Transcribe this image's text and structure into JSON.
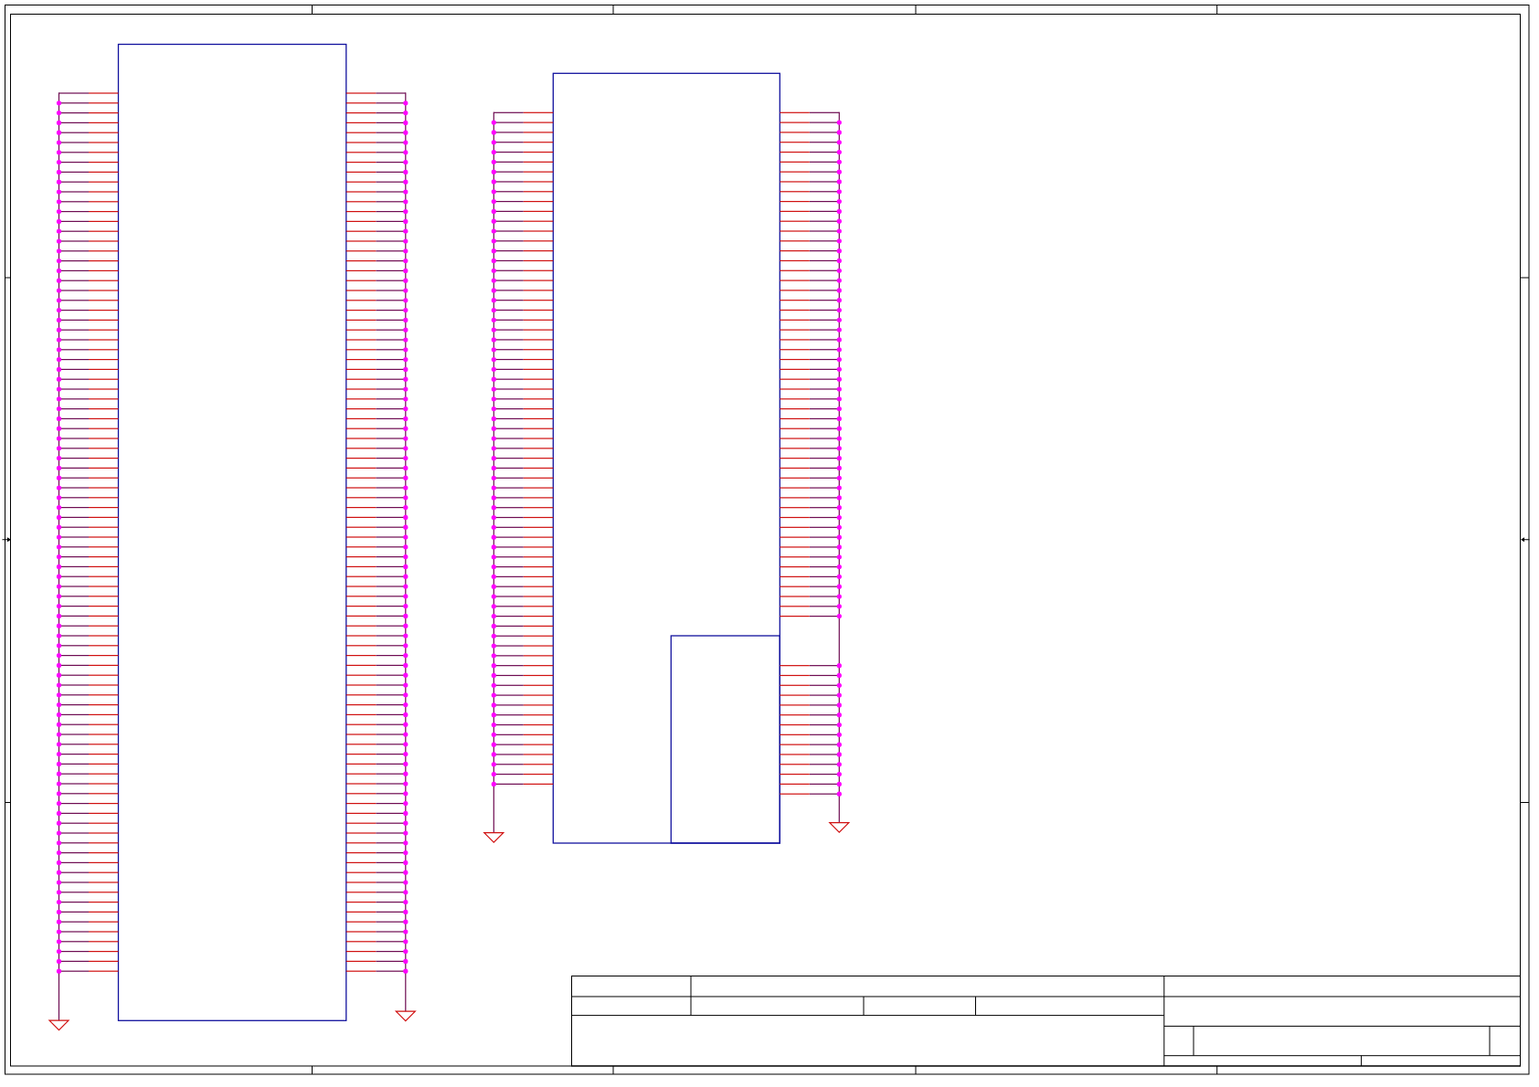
{
  "schematic": {
    "frame": true,
    "title_block": true,
    "components": [
      {
        "left_bus": {
          "ground": true,
          "pins": [
            {
              "kind": "pin"
            },
            {
              "kind": "pin"
            },
            {
              "kind": "pin"
            },
            {
              "kind": "pin"
            },
            {
              "kind": "pin"
            },
            {
              "kind": "pin"
            },
            {
              "kind": "pin"
            },
            {
              "kind": "pin"
            },
            {
              "kind": "pin"
            },
            {
              "kind": "pin"
            },
            {
              "kind": "pin"
            },
            {
              "kind": "pin"
            },
            {
              "kind": "pin"
            },
            {
              "kind": "pin"
            },
            {
              "kind": "pin"
            },
            {
              "kind": "pin"
            },
            {
              "kind": "pin"
            },
            {
              "kind": "pin"
            },
            {
              "kind": "pin"
            },
            {
              "kind": "pin"
            },
            {
              "kind": "pin"
            },
            {
              "kind": "pin"
            },
            {
              "kind": "pin"
            },
            {
              "kind": "pin"
            },
            {
              "kind": "pin"
            },
            {
              "kind": "pin"
            },
            {
              "kind": "pin"
            },
            {
              "kind": "pin"
            },
            {
              "kind": "pin"
            },
            {
              "kind": "pin"
            },
            {
              "kind": "pin"
            },
            {
              "kind": "pin"
            },
            {
              "kind": "pin"
            },
            {
              "kind": "pin"
            },
            {
              "kind": "pin"
            },
            {
              "kind": "pin"
            },
            {
              "kind": "pin"
            },
            {
              "kind": "pin"
            },
            {
              "kind": "pin"
            },
            {
              "kind": "pin"
            },
            {
              "kind": "pin"
            },
            {
              "kind": "pin"
            },
            {
              "kind": "pin"
            },
            {
              "kind": "pin"
            },
            {
              "kind": "pin"
            },
            {
              "kind": "pin"
            },
            {
              "kind": "pin"
            },
            {
              "kind": "pin"
            },
            {
              "kind": "pin"
            },
            {
              "kind": "pin"
            },
            {
              "kind": "pin"
            },
            {
              "kind": "pin"
            },
            {
              "kind": "pin"
            },
            {
              "kind": "pin"
            },
            {
              "kind": "pin"
            },
            {
              "kind": "pin"
            },
            {
              "kind": "pin"
            },
            {
              "kind": "pin"
            },
            {
              "kind": "pin"
            },
            {
              "kind": "pin"
            },
            {
              "kind": "pin"
            },
            {
              "kind": "pin"
            },
            {
              "kind": "pin"
            },
            {
              "kind": "pin"
            },
            {
              "kind": "pin"
            },
            {
              "kind": "pin"
            },
            {
              "kind": "pin"
            },
            {
              "kind": "pin"
            },
            {
              "kind": "pin"
            },
            {
              "kind": "pin"
            },
            {
              "kind": "pin"
            },
            {
              "kind": "pin"
            },
            {
              "kind": "pin"
            },
            {
              "kind": "pin"
            },
            {
              "kind": "pin"
            },
            {
              "kind": "pin"
            },
            {
              "kind": "pin"
            },
            {
              "kind": "pin"
            },
            {
              "kind": "pin"
            },
            {
              "kind": "pin"
            },
            {
              "kind": "pin"
            },
            {
              "kind": "pin"
            },
            {
              "kind": "pin"
            },
            {
              "kind": "pin"
            },
            {
              "kind": "pin"
            },
            {
              "kind": "pin"
            },
            {
              "kind": "pin"
            },
            {
              "kind": "pin"
            },
            {
              "kind": "pin"
            },
            {
              "kind": "pin"
            }
          ]
        },
        "right_bus": {
          "ground": true,
          "pins": [
            {
              "kind": "pin"
            },
            {
              "kind": "pin"
            },
            {
              "kind": "pin"
            },
            {
              "kind": "pin"
            },
            {
              "kind": "pin"
            },
            {
              "kind": "pin"
            },
            {
              "kind": "pin"
            },
            {
              "kind": "pin"
            },
            {
              "kind": "pin"
            },
            {
              "kind": "pin"
            },
            {
              "kind": "pin"
            },
            {
              "kind": "pin"
            },
            {
              "kind": "pin"
            },
            {
              "kind": "pin"
            },
            {
              "kind": "pin"
            },
            {
              "kind": "pin"
            },
            {
              "kind": "pin"
            },
            {
              "kind": "pin"
            },
            {
              "kind": "pin"
            },
            {
              "kind": "pin"
            },
            {
              "kind": "pin"
            },
            {
              "kind": "pin"
            },
            {
              "kind": "pin"
            },
            {
              "kind": "pin"
            },
            {
              "kind": "pin"
            },
            {
              "kind": "pin"
            },
            {
              "kind": "pin"
            },
            {
              "kind": "pin"
            },
            {
              "kind": "pin"
            },
            {
              "kind": "pin"
            },
            {
              "kind": "pin"
            },
            {
              "kind": "pin"
            },
            {
              "kind": "pin"
            },
            {
              "kind": "pin"
            },
            {
              "kind": "pin"
            },
            {
              "kind": "pin"
            },
            {
              "kind": "pin"
            },
            {
              "kind": "pin"
            },
            {
              "kind": "pin"
            },
            {
              "kind": "pin"
            },
            {
              "kind": "pin"
            },
            {
              "kind": "pin"
            },
            {
              "kind": "pin"
            },
            {
              "kind": "pin"
            },
            {
              "kind": "pin"
            },
            {
              "kind": "pin"
            },
            {
              "kind": "pin"
            },
            {
              "kind": "pin"
            },
            {
              "kind": "pin"
            },
            {
              "kind": "pin"
            },
            {
              "kind": "pin"
            },
            {
              "kind": "pin"
            },
            {
              "kind": "pin"
            },
            {
              "kind": "pin"
            },
            {
              "kind": "pin"
            },
            {
              "kind": "pin"
            },
            {
              "kind": "pin"
            },
            {
              "kind": "pin"
            },
            {
              "kind": "pin"
            },
            {
              "kind": "pin"
            },
            {
              "kind": "pin"
            },
            {
              "kind": "pin"
            },
            {
              "kind": "pin"
            },
            {
              "kind": "pin"
            },
            {
              "kind": "pin"
            },
            {
              "kind": "pin"
            },
            {
              "kind": "pin"
            },
            {
              "kind": "pin"
            },
            {
              "kind": "pin"
            },
            {
              "kind": "pin"
            },
            {
              "kind": "pin"
            },
            {
              "kind": "pin"
            },
            {
              "kind": "pin"
            },
            {
              "kind": "pin"
            },
            {
              "kind": "pin"
            },
            {
              "kind": "pin"
            },
            {
              "kind": "pin"
            },
            {
              "kind": "pin"
            },
            {
              "kind": "pin"
            },
            {
              "kind": "pin"
            },
            {
              "kind": "pin"
            },
            {
              "kind": "pin"
            },
            {
              "kind": "pin"
            },
            {
              "kind": "pin"
            },
            {
              "kind": "pin"
            },
            {
              "kind": "pin"
            },
            {
              "kind": "pin"
            },
            {
              "kind": "pin"
            },
            {
              "kind": "pin"
            },
            {
              "kind": "pin"
            }
          ]
        }
      },
      {
        "sub_block": true,
        "left_bus": {
          "ground": true,
          "pins": [
            {
              "kind": "pin"
            },
            {
              "kind": "pin"
            },
            {
              "kind": "pin"
            },
            {
              "kind": "pin"
            },
            {
              "kind": "pin"
            },
            {
              "kind": "pin"
            },
            {
              "kind": "pin"
            },
            {
              "kind": "pin"
            },
            {
              "kind": "pin"
            },
            {
              "kind": "pin"
            },
            {
              "kind": "pin"
            },
            {
              "kind": "pin"
            },
            {
              "kind": "pin"
            },
            {
              "kind": "pin"
            },
            {
              "kind": "pin"
            },
            {
              "kind": "pin"
            },
            {
              "kind": "pin"
            },
            {
              "kind": "pin"
            },
            {
              "kind": "pin"
            },
            {
              "kind": "pin"
            },
            {
              "kind": "pin"
            },
            {
              "kind": "pin"
            },
            {
              "kind": "pin"
            },
            {
              "kind": "pin"
            },
            {
              "kind": "pin"
            },
            {
              "kind": "pin"
            },
            {
              "kind": "pin"
            },
            {
              "kind": "pin"
            },
            {
              "kind": "pin"
            },
            {
              "kind": "pin"
            },
            {
              "kind": "pin"
            },
            {
              "kind": "pin"
            },
            {
              "kind": "pin"
            },
            {
              "kind": "pin"
            },
            {
              "kind": "pin"
            },
            {
              "kind": "pin"
            },
            {
              "kind": "pin"
            },
            {
              "kind": "pin"
            },
            {
              "kind": "pin"
            },
            {
              "kind": "pin"
            },
            {
              "kind": "pin"
            },
            {
              "kind": "pin"
            },
            {
              "kind": "pin"
            },
            {
              "kind": "pin"
            },
            {
              "kind": "pin"
            },
            {
              "kind": "pin"
            },
            {
              "kind": "pin"
            },
            {
              "kind": "pin"
            },
            {
              "kind": "pin"
            },
            {
              "kind": "pin"
            },
            {
              "kind": "pin"
            },
            {
              "kind": "pin"
            },
            {
              "kind": "pin"
            },
            {
              "kind": "pin"
            },
            {
              "kind": "pin"
            },
            {
              "kind": "pin"
            },
            {
              "kind": "pin"
            },
            {
              "kind": "pin"
            },
            {
              "kind": "pin"
            },
            {
              "kind": "pin"
            },
            {
              "kind": "pin"
            },
            {
              "kind": "pin"
            },
            {
              "kind": "pin"
            },
            {
              "kind": "pin"
            },
            {
              "kind": "pin"
            },
            {
              "kind": "pin"
            },
            {
              "kind": "pin"
            },
            {
              "kind": "pin"
            },
            {
              "kind": "pin"
            }
          ]
        },
        "right_bus": {
          "ground": true,
          "pins": [
            {
              "kind": "pin"
            },
            {
              "kind": "pin"
            },
            {
              "kind": "pin"
            },
            {
              "kind": "pin"
            },
            {
              "kind": "pin"
            },
            {
              "kind": "pin"
            },
            {
              "kind": "pin"
            },
            {
              "kind": "pin"
            },
            {
              "kind": "pin"
            },
            {
              "kind": "pin"
            },
            {
              "kind": "pin"
            },
            {
              "kind": "pin"
            },
            {
              "kind": "pin"
            },
            {
              "kind": "pin"
            },
            {
              "kind": "pin"
            },
            {
              "kind": "pin"
            },
            {
              "kind": "pin"
            },
            {
              "kind": "pin"
            },
            {
              "kind": "pin"
            },
            {
              "kind": "pin"
            },
            {
              "kind": "pin"
            },
            {
              "kind": "pin"
            },
            {
              "kind": "pin"
            },
            {
              "kind": "pin"
            },
            {
              "kind": "pin"
            },
            {
              "kind": "pin"
            },
            {
              "kind": "pin"
            },
            {
              "kind": "pin"
            },
            {
              "kind": "pin"
            },
            {
              "kind": "pin"
            },
            {
              "kind": "pin"
            },
            {
              "kind": "pin"
            },
            {
              "kind": "pin"
            },
            {
              "kind": "pin"
            },
            {
              "kind": "pin"
            },
            {
              "kind": "pin"
            },
            {
              "kind": "pin"
            },
            {
              "kind": "pin"
            },
            {
              "kind": "pin"
            },
            {
              "kind": "pin"
            },
            {
              "kind": "pin"
            },
            {
              "kind": "pin"
            },
            {
              "kind": "pin"
            },
            {
              "kind": "pin"
            },
            {
              "kind": "pin"
            },
            {
              "kind": "pin"
            },
            {
              "kind": "pin"
            },
            {
              "kind": "pin"
            },
            {
              "kind": "pin"
            },
            {
              "kind": "pin"
            },
            {
              "kind": "pin"
            },
            {
              "kind": "pin"
            },
            {
              "kind": "gap"
            },
            {
              "kind": "gap"
            },
            {
              "kind": "gap"
            },
            {
              "kind": "gap"
            },
            {
              "kind": "pin"
            },
            {
              "kind": "pin"
            },
            {
              "kind": "pin"
            },
            {
              "kind": "pin"
            },
            {
              "kind": "pin"
            },
            {
              "kind": "pin"
            },
            {
              "kind": "pin"
            },
            {
              "kind": "pin"
            },
            {
              "kind": "pin"
            },
            {
              "kind": "pin"
            },
            {
              "kind": "pin"
            },
            {
              "kind": "pin"
            },
            {
              "kind": "pin"
            },
            {
              "kind": "pin"
            }
          ]
        }
      }
    ]
  }
}
